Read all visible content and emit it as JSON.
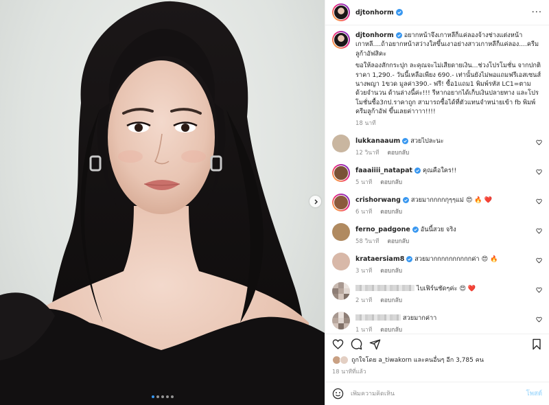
{
  "post": {
    "username": "djtonhorm",
    "carousel": {
      "slide_count": 5,
      "active_index": 0
    }
  },
  "caption": {
    "username": "djtonhorm",
    "line1": "อยากหน้าจึงเกาหลีก็แค่ลองจ้างช่างแต่งหน้าเกาหลี....ถ้าอยากหน้าสว่างใสขึ้นเงาอย่างสาวเกาหลีก็แค่ลอง....ครีมลูก้าอัฟสิคะ",
    "line2": "ขอให้ลองสักกระปุก ละคุณจะไม่เสียดายเงิน...ช่วงโปรโมชั่น จากปกติ ราคา 1,290.- วันนี้เหลือเพียง 690.- เท่านั้นยังไม่พอแถมฟรีเอสเซนส์นางพญา 1ขวด มูลค่า390.- ฟรี! ซื้อ1แถม1 พิมพ์รหัส LC1=ตามด้วยจำนวน ด้านล่างนี้ค่ะ!!! รีหากอยากได้เก็บเงินปลายทาง และโปรโมชั่นซื้อ3กป.ราคาถูก สามารถซื้อได้ที่ตัวแทนจำหน่ายเข้า fb พิมพ์ ครีมลูก้าอัฟ ขึ้นเลยค่าาาา!!!!",
    "time": "18 นาที"
  },
  "comments": [
    {
      "username": "lukkanaaum",
      "verified": true,
      "text": "สวยไปละนะ",
      "time": "12 วินาที",
      "reply": "ตอบกลับ",
      "avatar_color": "#c9b6a0"
    },
    {
      "username": "faaaiiii_natapat",
      "verified": true,
      "text": "คุณคือใคร!!",
      "time": "5 นาที",
      "reply": "ตอบกลับ",
      "avatar_color": "#7a5236",
      "story": true
    },
    {
      "username": "crishorwang",
      "verified": true,
      "text": "สวยมากกกกกุๆๆแม่ 😍 🔥 ❤️",
      "time": "6 นาที",
      "reply": "ตอบกลับ",
      "avatar_color": "#8b5a3c",
      "story": true
    },
    {
      "username": "ferno_padgone",
      "verified": true,
      "text": "อันนี้สวย จริง",
      "time": "58 วินาที",
      "reply": "ตอบกลับ",
      "avatar_color": "#b08a60"
    },
    {
      "username": "krataersiam8",
      "verified": true,
      "text": "สวยมากกกกกกกกกกค่า 😍 🔥",
      "time": "3 นาที",
      "reply": "ตอบกลับ",
      "avatar_color": "#d8b8a8"
    },
    {
      "username": "",
      "verified": false,
      "text": "ไบเฟิร์นชัดๆค่ะ 😍 ❤️",
      "time": "2 นาที",
      "reply": "ตอบกลับ",
      "pixelated": true
    },
    {
      "username": "",
      "verified": false,
      "text": "สวยมากค่าา",
      "time": "1 นาที",
      "reply": "ตอบกลับ",
      "pixelated": true
    }
  ],
  "likes": {
    "text": "ถูกใจโดย a_tiwakorn และคนอื่นๆ อีก 3,785 คน",
    "time": "18 นาทีที่แล้ว"
  },
  "add_comment": {
    "placeholder": "เพิ่มความคิดเห็น",
    "post_label": "โพสต์"
  },
  "colors": {
    "verified": "#3897f0",
    "muted": "#8e8e8e",
    "post_disabled": "#b2dffc",
    "text": "#262626"
  },
  "icons": [
    "verified-badge-icon",
    "more-icon",
    "heart-icon",
    "comment-icon",
    "share-icon",
    "bookmark-icon",
    "emoji-icon",
    "chevron-right-icon"
  ]
}
